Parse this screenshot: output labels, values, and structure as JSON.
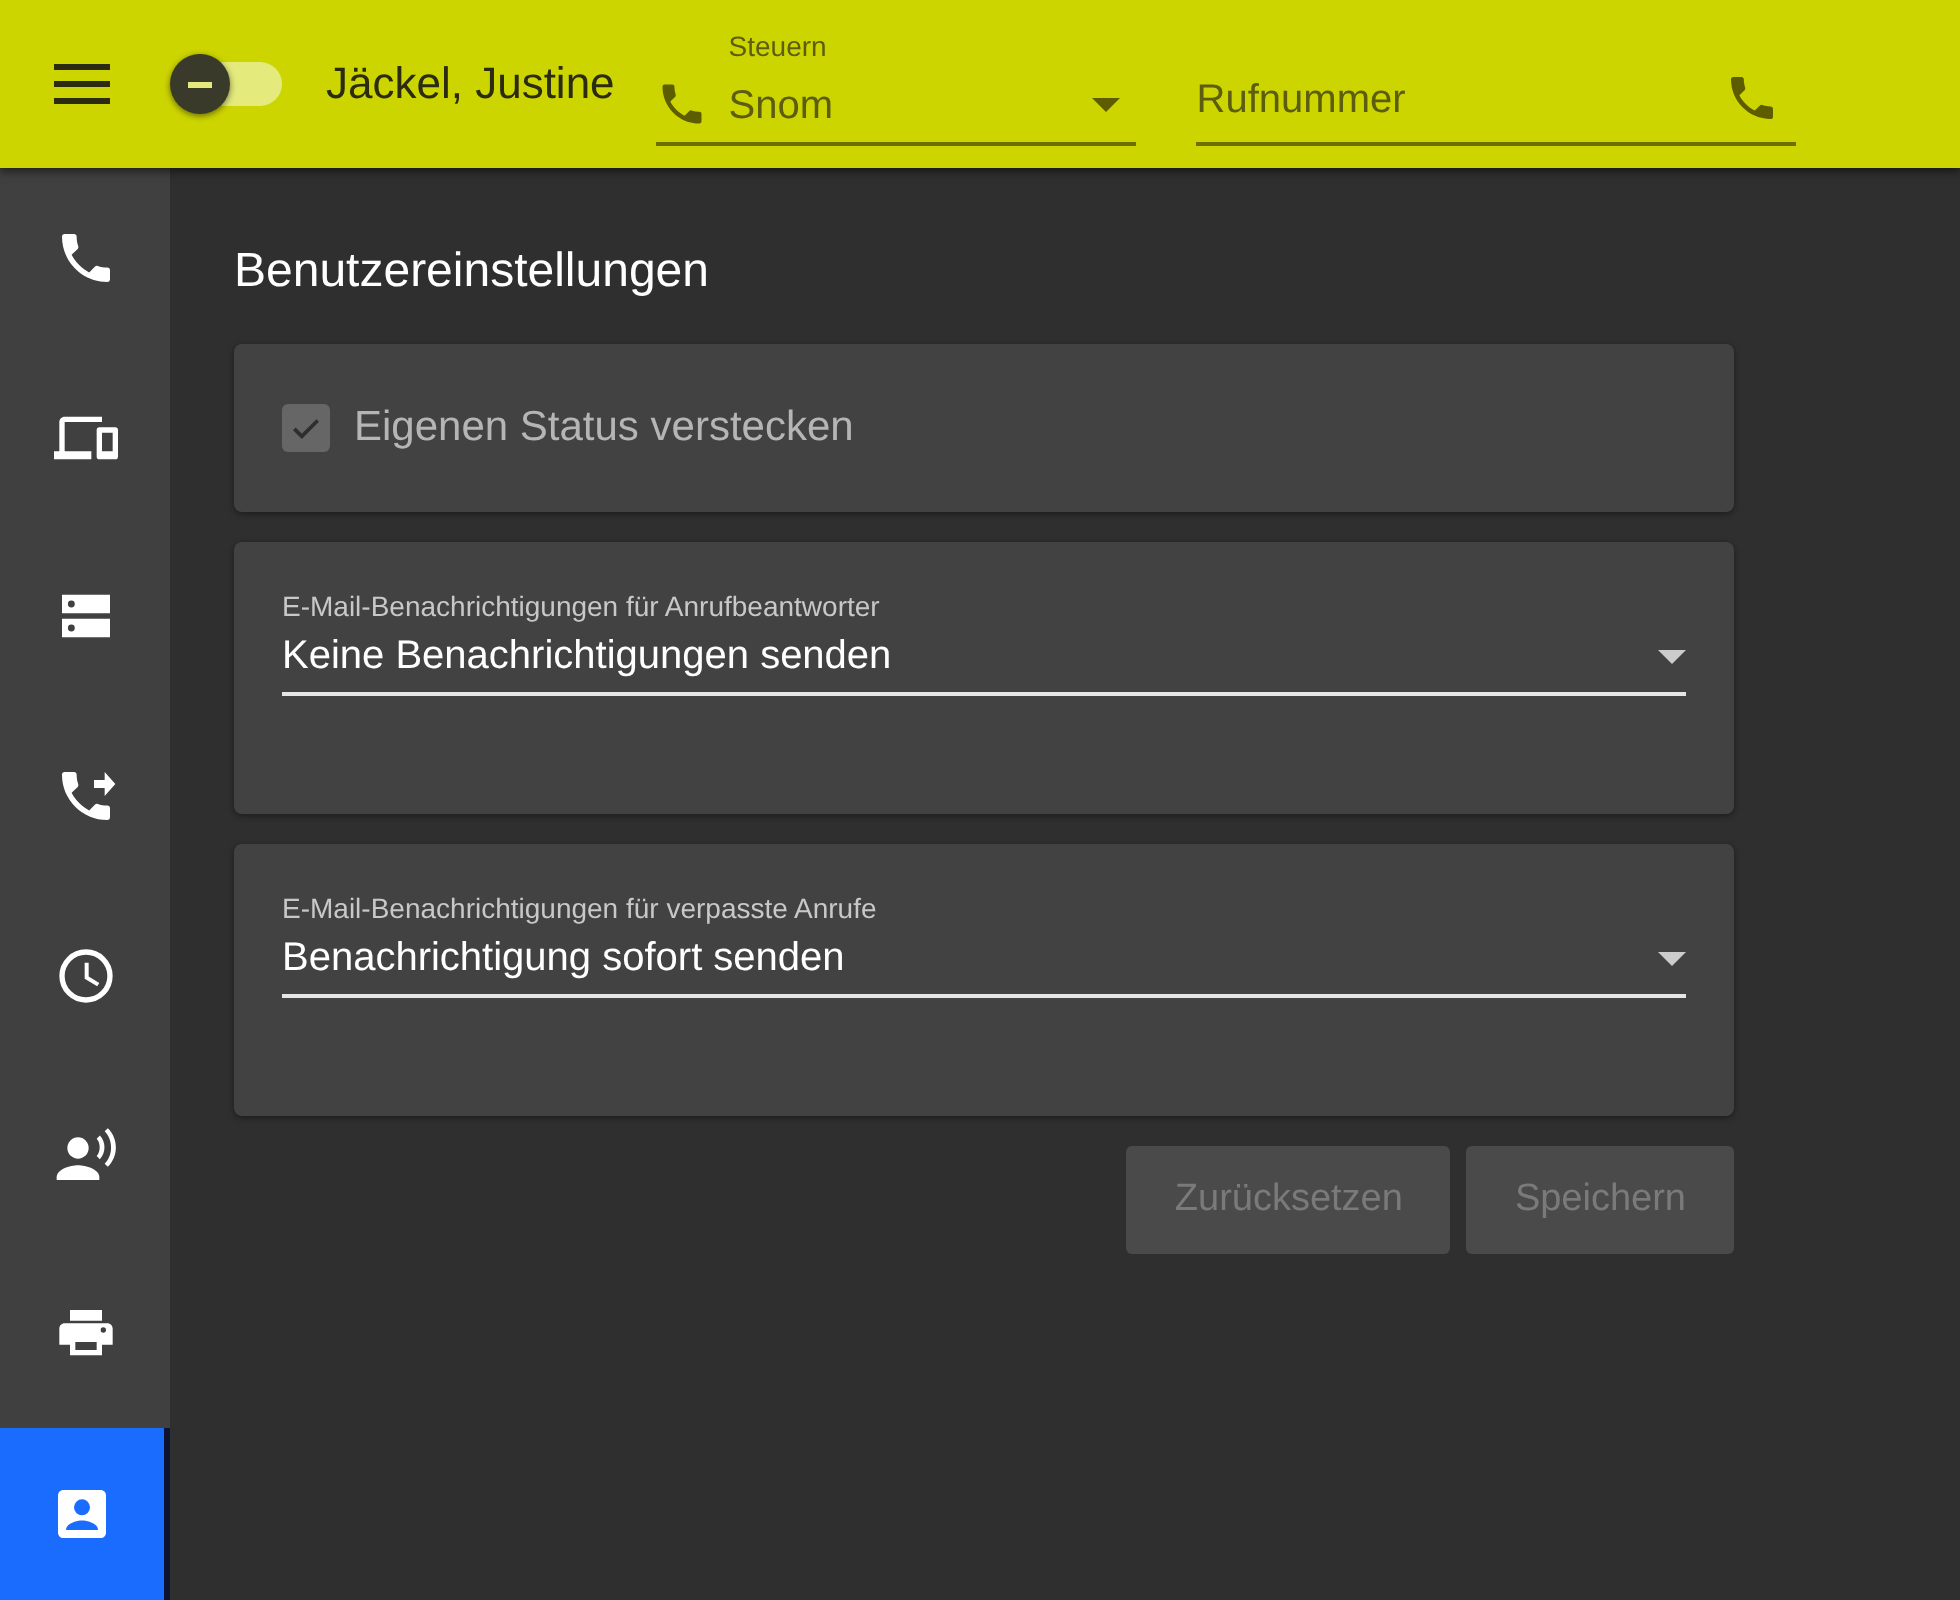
{
  "header": {
    "user_name": "Jäckel, Justine",
    "status_toggle": {
      "on": false
    },
    "device_select": {
      "label": "Steuern",
      "value": "Snom"
    },
    "dial_field": {
      "placeholder": "Rufnummer"
    }
  },
  "sidebar": {
    "items": [
      {
        "selected": false
      },
      {
        "selected": false
      },
      {
        "selected": false
      },
      {
        "selected": false
      },
      {
        "selected": false
      },
      {
        "selected": false
      },
      {
        "selected": false
      },
      {
        "selected": true
      }
    ]
  },
  "page": {
    "title": "Benutzereinstellungen",
    "hide_status": {
      "label": "Eigenen Status verstecken",
      "checked": true,
      "disabled": true
    },
    "selects": [
      {
        "label": "E-Mail-Benachrichtigungen für Anrufbeantworter",
        "value": "Keine Benachrichtigungen senden"
      },
      {
        "label": "E-Mail-Benachrichtigungen für verpasste Anrufe",
        "value": "Benachrichtigung sofort senden"
      }
    ],
    "buttons": [
      {
        "label": "Zurücksetzen",
        "disabled": true
      },
      {
        "label": "Speichern",
        "disabled": true
      }
    ]
  }
}
